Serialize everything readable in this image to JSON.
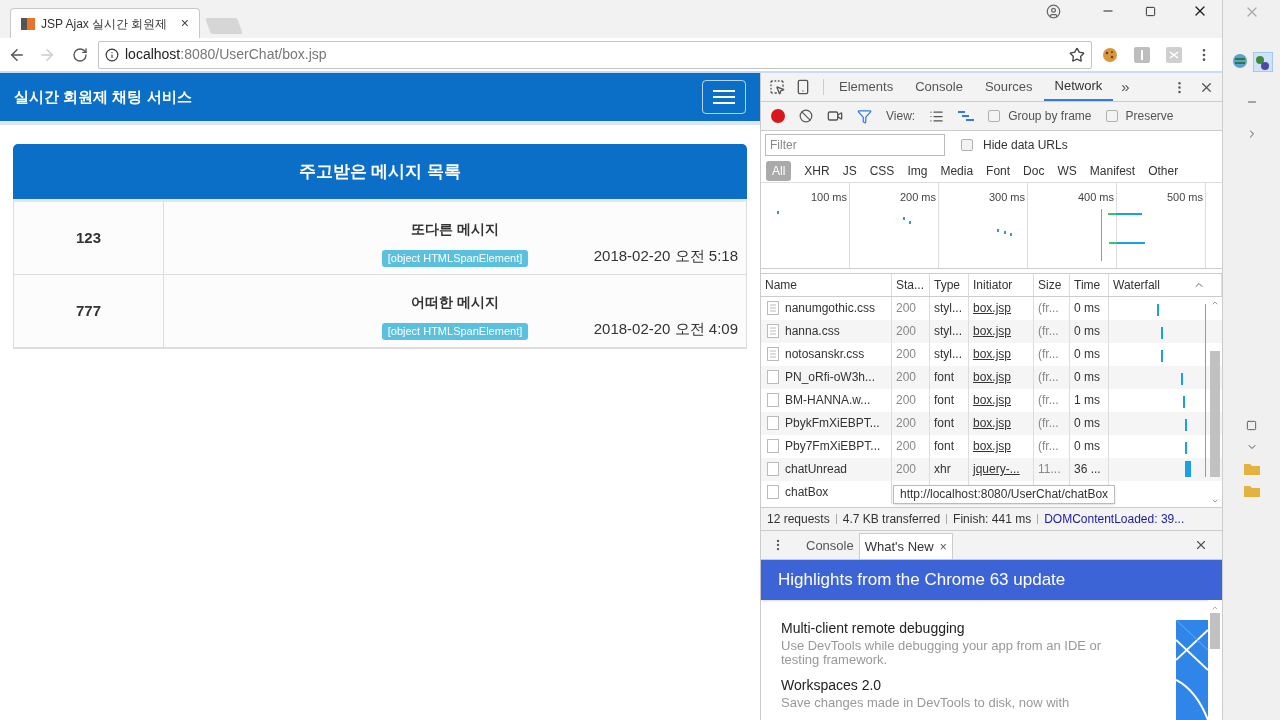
{
  "browser": {
    "tab": {
      "title": "JSP Ajax 실시간 회원제",
      "close": "×"
    },
    "url": {
      "host": "localhost",
      "rest": ":8080/UserChat/box.jsp"
    }
  },
  "page": {
    "brand": "실시간 회원제 채팅 서비스",
    "heading": "주고받은 메시지 목록",
    "messages": [
      {
        "sender": "123",
        "text": "또다른 메시지",
        "badge": "[object HTMLSpanElement]",
        "time": "2018-02-20 오전 5:18"
      },
      {
        "sender": "777",
        "text": "어떠한 메시지",
        "badge": "[object HTMLSpanElement]",
        "time": "2018-02-20 오전 4:09"
      }
    ]
  },
  "devtools": {
    "tabs": [
      {
        "label": "Elements",
        "selected": false
      },
      {
        "label": "Console",
        "selected": false
      },
      {
        "label": "Sources",
        "selected": false
      },
      {
        "label": "Network",
        "selected": true
      }
    ],
    "more": "»",
    "view_label": "View:",
    "group_by_frame": {
      "label": "Group by frame",
      "checked": false
    },
    "preserve": {
      "label": "Preserve",
      "checked": false
    },
    "filter": {
      "placeholder": "Filter"
    },
    "hide_data_urls": {
      "label": "Hide data URLs",
      "checked": false
    },
    "type_filters": [
      {
        "label": "All",
        "selected": true
      },
      {
        "label": "XHR",
        "selected": false
      },
      {
        "label": "JS",
        "selected": false
      },
      {
        "label": "CSS",
        "selected": false
      },
      {
        "label": "Img",
        "selected": false
      },
      {
        "label": "Media",
        "selected": false
      },
      {
        "label": "Font",
        "selected": false
      },
      {
        "label": "Doc",
        "selected": false
      },
      {
        "label": "WS",
        "selected": false
      },
      {
        "label": "Manifest",
        "selected": false
      },
      {
        "label": "Other",
        "selected": false
      }
    ],
    "overview_ticks": [
      "100 ms",
      "200 ms",
      "300 ms",
      "400 ms",
      "500 ms"
    ],
    "columns": [
      "Name",
      "Sta...",
      "Type",
      "Initiator",
      "Size",
      "Time",
      "Waterfall"
    ],
    "rows": [
      {
        "kind": "stylesheet",
        "name": "nanumgothic.css",
        "status": "200",
        "type": "styl...",
        "initiator": "box.jsp",
        "size": "(fr...",
        "time": "0 ms"
      },
      {
        "kind": "stylesheet",
        "name": "hanna.css",
        "status": "200",
        "type": "styl...",
        "initiator": "box.jsp",
        "size": "(fr...",
        "time": "0 ms"
      },
      {
        "kind": "stylesheet",
        "name": "notosanskr.css",
        "status": "200",
        "type": "styl...",
        "initiator": "box.jsp",
        "size": "(fr...",
        "time": "0 ms"
      },
      {
        "kind": "file",
        "name": "PN_oRfi-oW3h...",
        "status": "200",
        "type": "font",
        "initiator": "box.jsp",
        "size": "(fr...",
        "time": "0 ms"
      },
      {
        "kind": "file",
        "name": "BM-HANNA.w...",
        "status": "200",
        "type": "font",
        "initiator": "box.jsp",
        "size": "(fr...",
        "time": "1 ms"
      },
      {
        "kind": "file",
        "name": "PbykFmXiEBPT...",
        "status": "200",
        "type": "font",
        "initiator": "box.jsp",
        "size": "(fr...",
        "time": "0 ms"
      },
      {
        "kind": "file",
        "name": "Pby7FmXiEBPT...",
        "status": "200",
        "type": "font",
        "initiator": "box.jsp",
        "size": "(fr...",
        "time": "0 ms"
      },
      {
        "kind": "file",
        "name": "chatUnread",
        "status": "200",
        "type": "xhr",
        "initiator": "jquery-...",
        "size": "11...",
        "time": "36 ..."
      },
      {
        "kind": "file",
        "name": "chatBox"
      }
    ],
    "tooltip": "http://localhost:8080/UserChat/chatBox",
    "summary": [
      "12 requests",
      "4.7 KB transferred",
      "Finish: 441 ms"
    ],
    "dom_content_loaded": "DOMContentLoaded: 39...",
    "drawer": {
      "tabs": [
        {
          "label": "Console",
          "selected": false
        },
        {
          "label": "What's New",
          "selected": true,
          "close": "×"
        }
      ],
      "banner": "Highlights from the Chrome 63 update",
      "items": [
        {
          "title": "Multi-client remote debugging",
          "description": "Use DevTools while debugging your app from an IDE or testing framework."
        },
        {
          "title": "Workspaces 2.0",
          "description": "Save changes made in DevTools to disk, now with"
        }
      ]
    }
  }
}
